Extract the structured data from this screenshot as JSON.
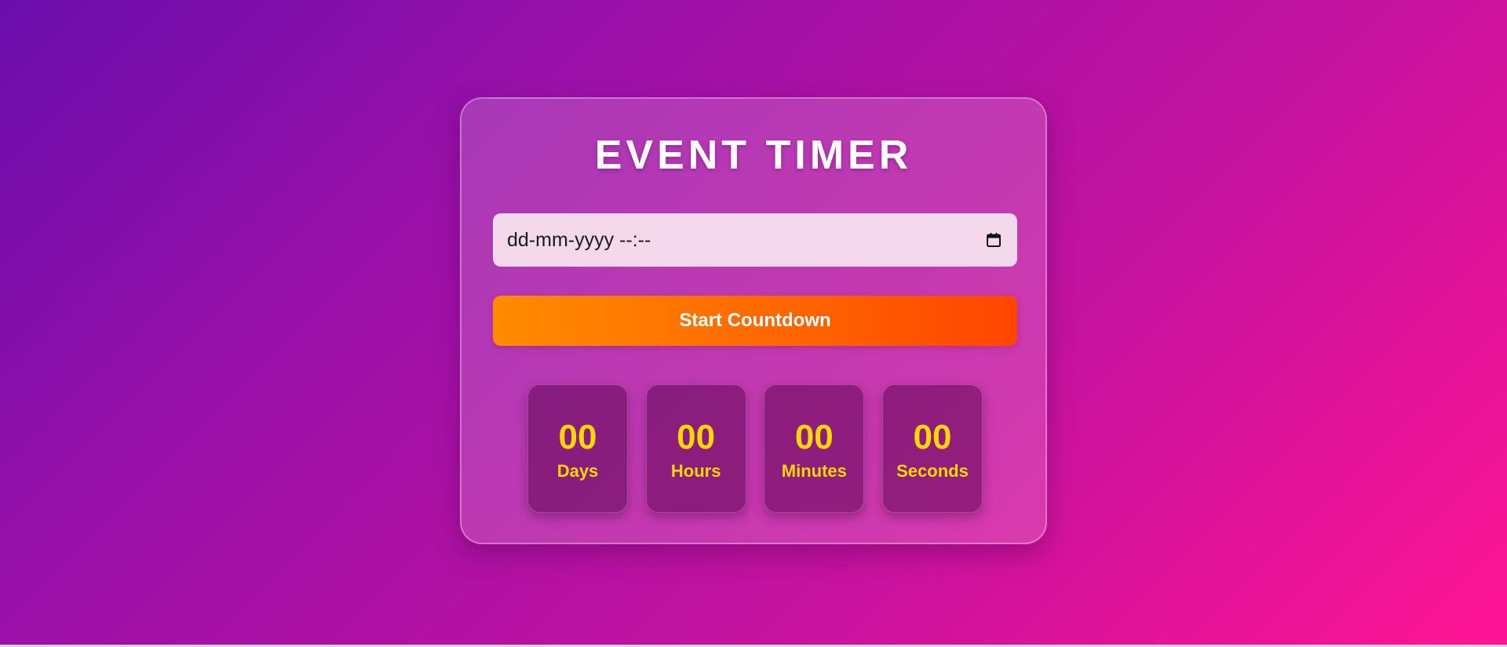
{
  "timer": {
    "title": "EVENT TIMER",
    "date_input": {
      "value": "dd-mm-yyyy --:--",
      "icon": "calendar-icon"
    },
    "start_button_label": "Start Countdown",
    "units": [
      {
        "value": "00",
        "label": "Days"
      },
      {
        "value": "00",
        "label": "Hours"
      },
      {
        "value": "00",
        "label": "Minutes"
      },
      {
        "value": "00",
        "label": "Seconds"
      }
    ]
  },
  "colors": {
    "background_start": "#6a0dad",
    "background_end": "#ff1493",
    "button_start": "#ff8c00",
    "button_end": "#ff4500",
    "accent_text": "#ffd700",
    "input_background": "#f4d8ec"
  }
}
